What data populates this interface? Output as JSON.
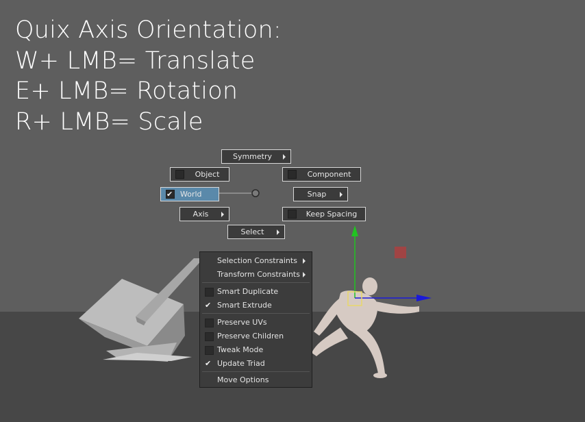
{
  "overlay": {
    "lines": [
      "Quix Axis Orientation:",
      "W+ LMB= Translate",
      "E+ LMB= Rotation",
      "R+ LMB= Scale"
    ]
  },
  "marking_menu": {
    "symmetry": "Symmetry",
    "object": "Object",
    "component": "Component",
    "world": "World",
    "snap": "Snap",
    "axis": "Axis",
    "keep_spacing": "Keep Spacing",
    "select": "Select"
  },
  "context_menu": {
    "items": [
      {
        "label": "Selection Constraints",
        "submenu": true
      },
      {
        "label": "Transform Constraints",
        "submenu": true
      },
      {
        "label": "Smart Duplicate",
        "checked": false
      },
      {
        "label": "Smart Extrude",
        "checked": true
      },
      {
        "label": "Preserve UVs",
        "checked": false
      },
      {
        "label": "Preserve Children",
        "checked": false
      },
      {
        "label": "Tweak Mode",
        "checked": false
      },
      {
        "label": "Update Triad",
        "checked": true
      },
      {
        "label": "Move Options"
      }
    ]
  },
  "colors": {
    "selected": "#5a89aa",
    "gizmo_y": "#21c421",
    "gizmo_x": "#1a1ad8",
    "gizmo_z_handle": "#a04444",
    "pivot": "#e8d86a"
  }
}
